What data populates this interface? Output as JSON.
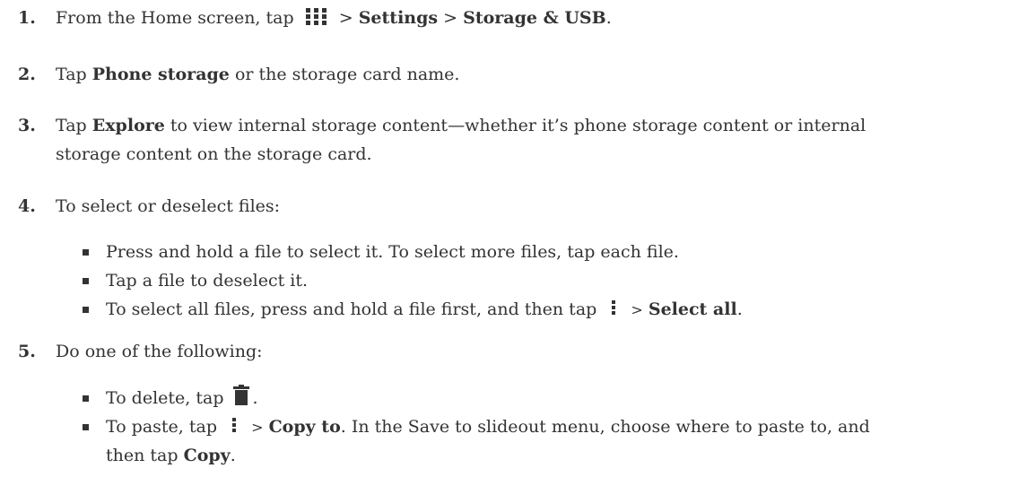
{
  "step1": {
    "num": "1.",
    "pre": "From the Home screen, tap",
    "sep1": ">",
    "b1": "Settings",
    "sep2": ">",
    "b2": "Storage & USB",
    "post": "."
  },
  "step2": {
    "num": "2.",
    "pre": "Tap",
    "b1": "Phone storage",
    "post": "or the storage card name."
  },
  "step3": {
    "num": "3.",
    "pre": "Tap",
    "b1": "Explore",
    "line1_post": "to view internal storage content—whether it’s phone storage content or internal",
    "line2": "storage content on the storage card."
  },
  "step4": {
    "num": "4.",
    "text": "To select or deselect files:",
    "bullets": [
      "Press and hold a file to select it. To select more files, tap each file.",
      "Tap a file to deselect it."
    ],
    "bullet3": {
      "pre": "To select all files, press and hold a file first, and then tap",
      "sep": ">",
      "b": "Select all",
      "post": "."
    }
  },
  "step5": {
    "num": "5.",
    "text": "Do one of the following:",
    "bullet1": {
      "pre": "To delete, tap",
      "post": "."
    },
    "bullet2": {
      "pre": "To paste, tap",
      "sep": ">",
      "b1": "Copy to",
      "mid": ". In the Save to slideout menu, choose where to paste to, and",
      "line2_pre": "then tap",
      "b2": "Copy",
      "line2_post": "."
    }
  },
  "icons": {
    "apps": "apps-grid-icon",
    "overflow": "overflow-menu-icon",
    "trash": "trash-icon"
  }
}
